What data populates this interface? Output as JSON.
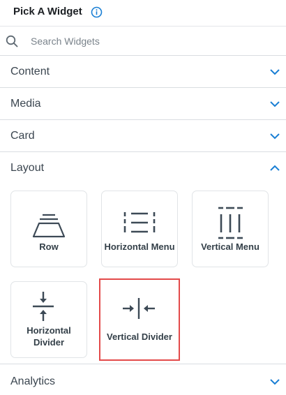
{
  "header": {
    "title": "Pick A Widget",
    "info_icon": "info-icon",
    "accent": "#1a7fd4"
  },
  "search": {
    "placeholder": "Search Widgets",
    "value": "",
    "icon": "search-icon"
  },
  "sections": [
    {
      "label": "Content",
      "expanded": false
    },
    {
      "label": "Media",
      "expanded": false
    },
    {
      "label": "Card",
      "expanded": false
    },
    {
      "label": "Layout",
      "expanded": true
    },
    {
      "label": "Analytics",
      "expanded": false
    }
  ],
  "layout_widgets": [
    {
      "label": "Row",
      "icon": "row-icon",
      "selected": false
    },
    {
      "label": "Horizontal Menu",
      "icon": "horizontal-menu-icon",
      "selected": false
    },
    {
      "label": "Vertical Menu",
      "icon": "vertical-menu-icon",
      "selected": false
    },
    {
      "label_line1": "Horizontal",
      "label_line2": "Divider",
      "icon": "horizontal-divider-icon",
      "selected": false
    },
    {
      "label": "Vertical Divider",
      "icon": "vertical-divider-icon",
      "selected": true
    }
  ],
  "colors": {
    "chevron": "#1a7fd4",
    "selected_border": "#e34a4a",
    "icon_stroke": "#3d4a56"
  }
}
